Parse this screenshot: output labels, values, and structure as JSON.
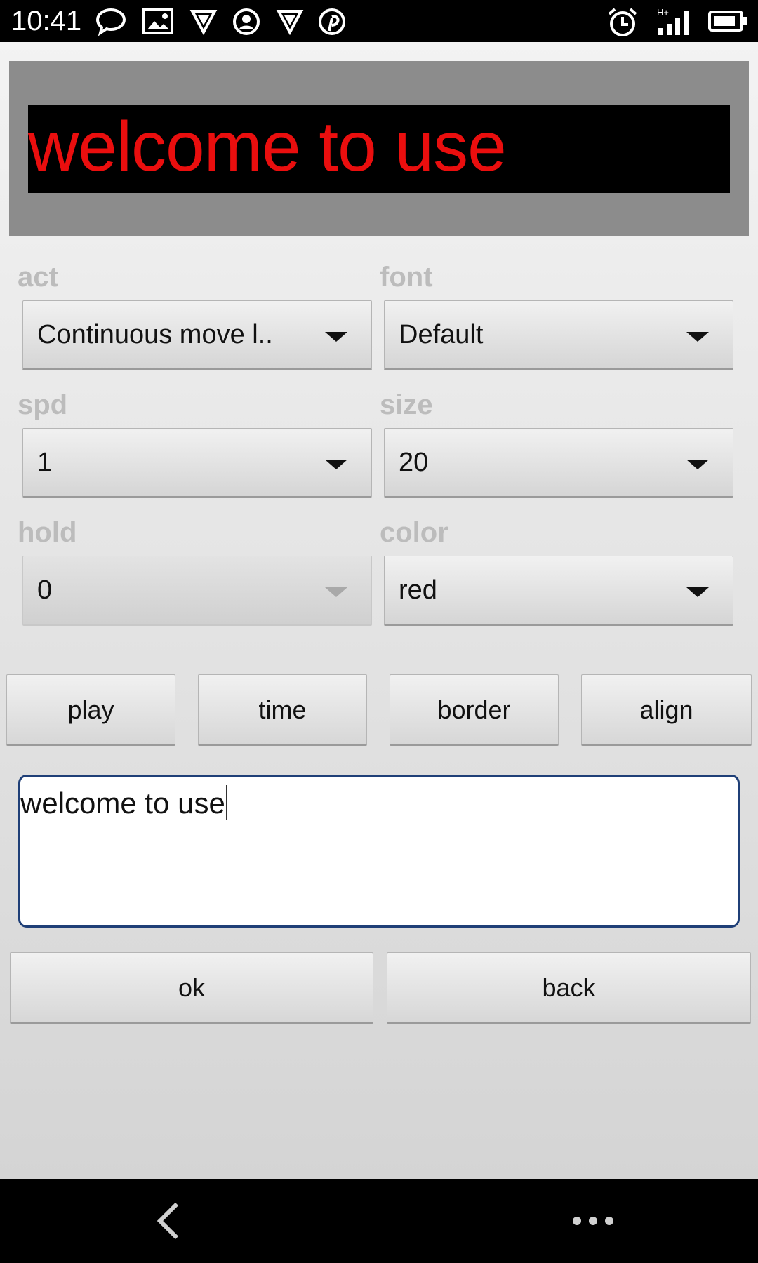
{
  "status_bar": {
    "time": "10:41",
    "left_icons": [
      "chat-bubble-icon",
      "image-icon",
      "vpn-shield-icon",
      "sync-user-icon",
      "vpn-shield-icon",
      "pinterest-icon"
    ],
    "right_icons": [
      "alarm-icon",
      "signal-h-plus-icon",
      "battery-icon"
    ]
  },
  "preview": {
    "text": "welcome to use",
    "text_color": "#ea0e0e",
    "background": "#000000"
  },
  "fields": {
    "act": {
      "label": "act",
      "value": "Continuous move l.."
    },
    "font": {
      "label": "font",
      "value": "Default"
    },
    "spd": {
      "label": "spd",
      "value": "1"
    },
    "size": {
      "label": "size",
      "value": "20"
    },
    "hold": {
      "label": "hold",
      "value": "0",
      "enabled": false
    },
    "color": {
      "label": "color",
      "value": "red"
    }
  },
  "buttons": {
    "play": "play",
    "time": "time",
    "border": "border",
    "align": "align",
    "ok": "ok",
    "back": "back"
  },
  "message_input": {
    "value": "welcome to use"
  },
  "nav_bar": {
    "icons": [
      "back-icon",
      "more-icon"
    ]
  }
}
